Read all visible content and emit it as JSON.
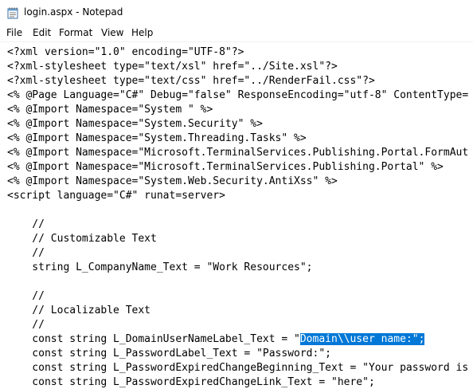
{
  "window": {
    "title": "login.aspx - Notepad",
    "icon": "notepad-icon"
  },
  "menu": [
    "File",
    "Edit",
    "Format",
    "View",
    "Help"
  ],
  "editor": {
    "lines": [
      {
        "pre": "<?xml version=\"1.0\" encoding=\"UTF-8\"?>",
        "sel": "",
        "post": ""
      },
      {
        "pre": "<?xml-stylesheet type=\"text/xsl\" href=\"../Site.xsl\"?>",
        "sel": "",
        "post": ""
      },
      {
        "pre": "<?xml-stylesheet type=\"text/css\" href=\"../RenderFail.css\"?>",
        "sel": "",
        "post": ""
      },
      {
        "pre": "<% @Page Language=\"C#\" Debug=\"false\" ResponseEncoding=\"utf-8\" ContentType=",
        "sel": "",
        "post": ""
      },
      {
        "pre": "<% @Import Namespace=\"System \" %>",
        "sel": "",
        "post": ""
      },
      {
        "pre": "<% @Import Namespace=\"System.Security\" %>",
        "sel": "",
        "post": ""
      },
      {
        "pre": "<% @Import Namespace=\"System.Threading.Tasks\" %>",
        "sel": "",
        "post": ""
      },
      {
        "pre": "<% @Import Namespace=\"Microsoft.TerminalServices.Publishing.Portal.FormAut",
        "sel": "",
        "post": ""
      },
      {
        "pre": "<% @Import Namespace=\"Microsoft.TerminalServices.Publishing.Portal\" %>",
        "sel": "",
        "post": ""
      },
      {
        "pre": "<% @Import Namespace=\"System.Web.Security.AntiXss\" %>",
        "sel": "",
        "post": ""
      },
      {
        "pre": "<script language=\"C#\" runat=server>",
        "sel": "",
        "post": ""
      },
      {
        "pre": "",
        "sel": "",
        "post": ""
      },
      {
        "pre": "    //",
        "sel": "",
        "post": ""
      },
      {
        "pre": "    // Customizable Text",
        "sel": "",
        "post": ""
      },
      {
        "pre": "    //",
        "sel": "",
        "post": ""
      },
      {
        "pre": "    string L_CompanyName_Text = \"Work Resources\";",
        "sel": "",
        "post": ""
      },
      {
        "pre": "",
        "sel": "",
        "post": ""
      },
      {
        "pre": "    //",
        "sel": "",
        "post": ""
      },
      {
        "pre": "    // Localizable Text",
        "sel": "",
        "post": ""
      },
      {
        "pre": "    //",
        "sel": "",
        "post": ""
      },
      {
        "pre": "    const string L_DomainUserNameLabel_Text = \"",
        "sel": "Domain\\\\user name:\";",
        "post": ""
      },
      {
        "pre": "    const string L_PasswordLabel_Text = \"Password:\";",
        "sel": "",
        "post": ""
      },
      {
        "pre": "    const string L_PasswordExpiredChangeBeginning_Text = \"Your password is",
        "sel": "",
        "post": ""
      },
      {
        "pre": "    const string L_PasswordExpiredChangeLink_Text = \"here\";",
        "sel": "",
        "post": ""
      }
    ]
  }
}
